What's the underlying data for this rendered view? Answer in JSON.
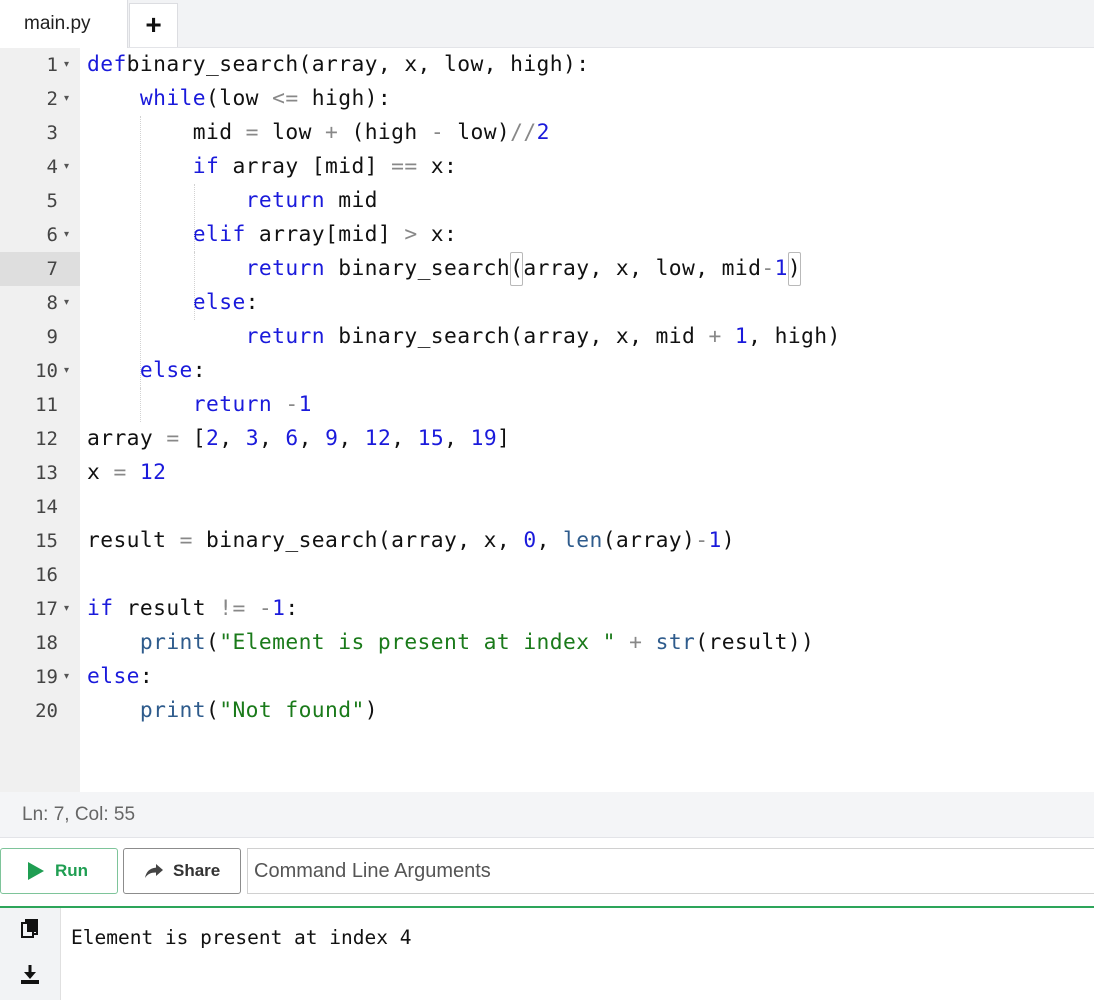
{
  "tabs": {
    "file_name": "main.py",
    "add_label": "+"
  },
  "editor": {
    "lines": [
      {
        "num": "1",
        "fold": true
      },
      {
        "num": "2",
        "fold": true
      },
      {
        "num": "3",
        "fold": false
      },
      {
        "num": "4",
        "fold": true
      },
      {
        "num": "5",
        "fold": false
      },
      {
        "num": "6",
        "fold": true
      },
      {
        "num": "7",
        "fold": false,
        "active": true
      },
      {
        "num": "8",
        "fold": true
      },
      {
        "num": "9",
        "fold": false
      },
      {
        "num": "10",
        "fold": true
      },
      {
        "num": "11",
        "fold": false
      },
      {
        "num": "12",
        "fold": false
      },
      {
        "num": "13",
        "fold": false
      },
      {
        "num": "14",
        "fold": false
      },
      {
        "num": "15",
        "fold": false
      },
      {
        "num": "16",
        "fold": false
      },
      {
        "num": "17",
        "fold": true
      },
      {
        "num": "18",
        "fold": false
      },
      {
        "num": "19",
        "fold": true
      },
      {
        "num": "20",
        "fold": false
      }
    ],
    "code": [
      [
        [
          "kw",
          "def"
        ],
        [
          "",
          "binary_search(array, x, low, high):"
        ]
      ],
      [
        [
          "",
          "    "
        ],
        [
          "kw",
          "while"
        ],
        [
          "",
          "(low "
        ],
        [
          "op",
          "<="
        ],
        [
          "",
          " high):"
        ]
      ],
      [
        [
          "",
          "        mid "
        ],
        [
          "op",
          "="
        ],
        [
          "",
          " low "
        ],
        [
          "op",
          "+"
        ],
        [
          "",
          " (high "
        ],
        [
          "op",
          "-"
        ],
        [
          "",
          " low)"
        ],
        [
          "op",
          "//"
        ],
        [
          "num",
          "2"
        ]
      ],
      [
        [
          "",
          "        "
        ],
        [
          "kw",
          "if"
        ],
        [
          "",
          " array [mid] "
        ],
        [
          "op",
          "=="
        ],
        [
          "",
          " x:"
        ]
      ],
      [
        [
          "",
          "            "
        ],
        [
          "kw",
          "return"
        ],
        [
          "",
          " mid"
        ]
      ],
      [
        [
          "",
          "        "
        ],
        [
          "kw",
          "elif"
        ],
        [
          "",
          " array[mid] "
        ],
        [
          "op",
          ">"
        ],
        [
          "",
          " x:"
        ]
      ],
      [
        [
          "",
          "            "
        ],
        [
          "kw",
          "return"
        ],
        [
          "",
          " binary_search"
        ],
        [
          "cur",
          "("
        ],
        [
          "",
          "array, x, low, mid"
        ],
        [
          "op",
          "-"
        ],
        [
          "num",
          "1"
        ],
        [
          "cur",
          ")"
        ]
      ],
      [
        [
          "",
          "        "
        ],
        [
          "kw",
          "else"
        ],
        [
          "",
          ":"
        ]
      ],
      [
        [
          "",
          "            "
        ],
        [
          "kw",
          "return"
        ],
        [
          "",
          " binary_search(array, x, mid "
        ],
        [
          "op",
          "+"
        ],
        [
          "",
          " "
        ],
        [
          "num",
          "1"
        ],
        [
          "",
          ", high)"
        ]
      ],
      [
        [
          "",
          "    "
        ],
        [
          "kw",
          "else"
        ],
        [
          "",
          ":"
        ]
      ],
      [
        [
          "",
          "        "
        ],
        [
          "kw",
          "return"
        ],
        [
          "",
          " "
        ],
        [
          "op",
          "-"
        ],
        [
          "num",
          "1"
        ]
      ],
      [
        [
          "",
          "array "
        ],
        [
          "op",
          "="
        ],
        [
          "",
          " ["
        ],
        [
          "num",
          "2"
        ],
        [
          "",
          ", "
        ],
        [
          "num",
          "3"
        ],
        [
          "",
          ", "
        ],
        [
          "num",
          "6"
        ],
        [
          "",
          ", "
        ],
        [
          "num",
          "9"
        ],
        [
          "",
          ", "
        ],
        [
          "num",
          "12"
        ],
        [
          "",
          ", "
        ],
        [
          "num",
          "15"
        ],
        [
          "",
          ", "
        ],
        [
          "num",
          "19"
        ],
        [
          "",
          "]"
        ]
      ],
      [
        [
          "",
          "x "
        ],
        [
          "op",
          "="
        ],
        [
          "",
          " "
        ],
        [
          "num",
          "12"
        ]
      ],
      [],
      [
        [
          "",
          "result "
        ],
        [
          "op",
          "="
        ],
        [
          "",
          " binary_search(array, x, "
        ],
        [
          "num",
          "0"
        ],
        [
          "",
          ", "
        ],
        [
          "bi",
          "len"
        ],
        [
          "",
          "(array)"
        ],
        [
          "op",
          "-"
        ],
        [
          "num",
          "1"
        ],
        [
          "",
          ")"
        ]
      ],
      [],
      [
        [
          "kw",
          "if"
        ],
        [
          "",
          " result "
        ],
        [
          "op",
          "!="
        ],
        [
          "",
          " "
        ],
        [
          "op",
          "-"
        ],
        [
          "num",
          "1"
        ],
        [
          "",
          ":"
        ]
      ],
      [
        [
          "",
          "    "
        ],
        [
          "bi",
          "print"
        ],
        [
          "",
          "("
        ],
        [
          "str",
          "\"Element is present at index \""
        ],
        [
          "",
          " "
        ],
        [
          "op",
          "+"
        ],
        [
          "",
          " "
        ],
        [
          "bi",
          "str"
        ],
        [
          "",
          "(result))"
        ]
      ],
      [
        [
          "kw",
          "else"
        ],
        [
          "",
          ":"
        ]
      ],
      [
        [
          "",
          "    "
        ],
        [
          "bi",
          "print"
        ],
        [
          "",
          "("
        ],
        [
          "str",
          "\"Not found\""
        ],
        [
          "",
          ")"
        ]
      ]
    ]
  },
  "status": {
    "position": "Ln: 7,  Col: 55"
  },
  "toolbar": {
    "run_label": "Run",
    "share_label": "Share",
    "args_placeholder": "Command Line Arguments",
    "args_value": ""
  },
  "output": {
    "text": "Element is present at index 4",
    "icons": [
      "copy-icon",
      "download-icon"
    ]
  },
  "colors": {
    "keyword": "#1a1adb",
    "number": "#1a1adb",
    "operator": "#888888",
    "string": "#1a7a1a",
    "builtin": "#2e5b8c",
    "run_green": "#1f9e52",
    "output_border": "#2da55a"
  }
}
